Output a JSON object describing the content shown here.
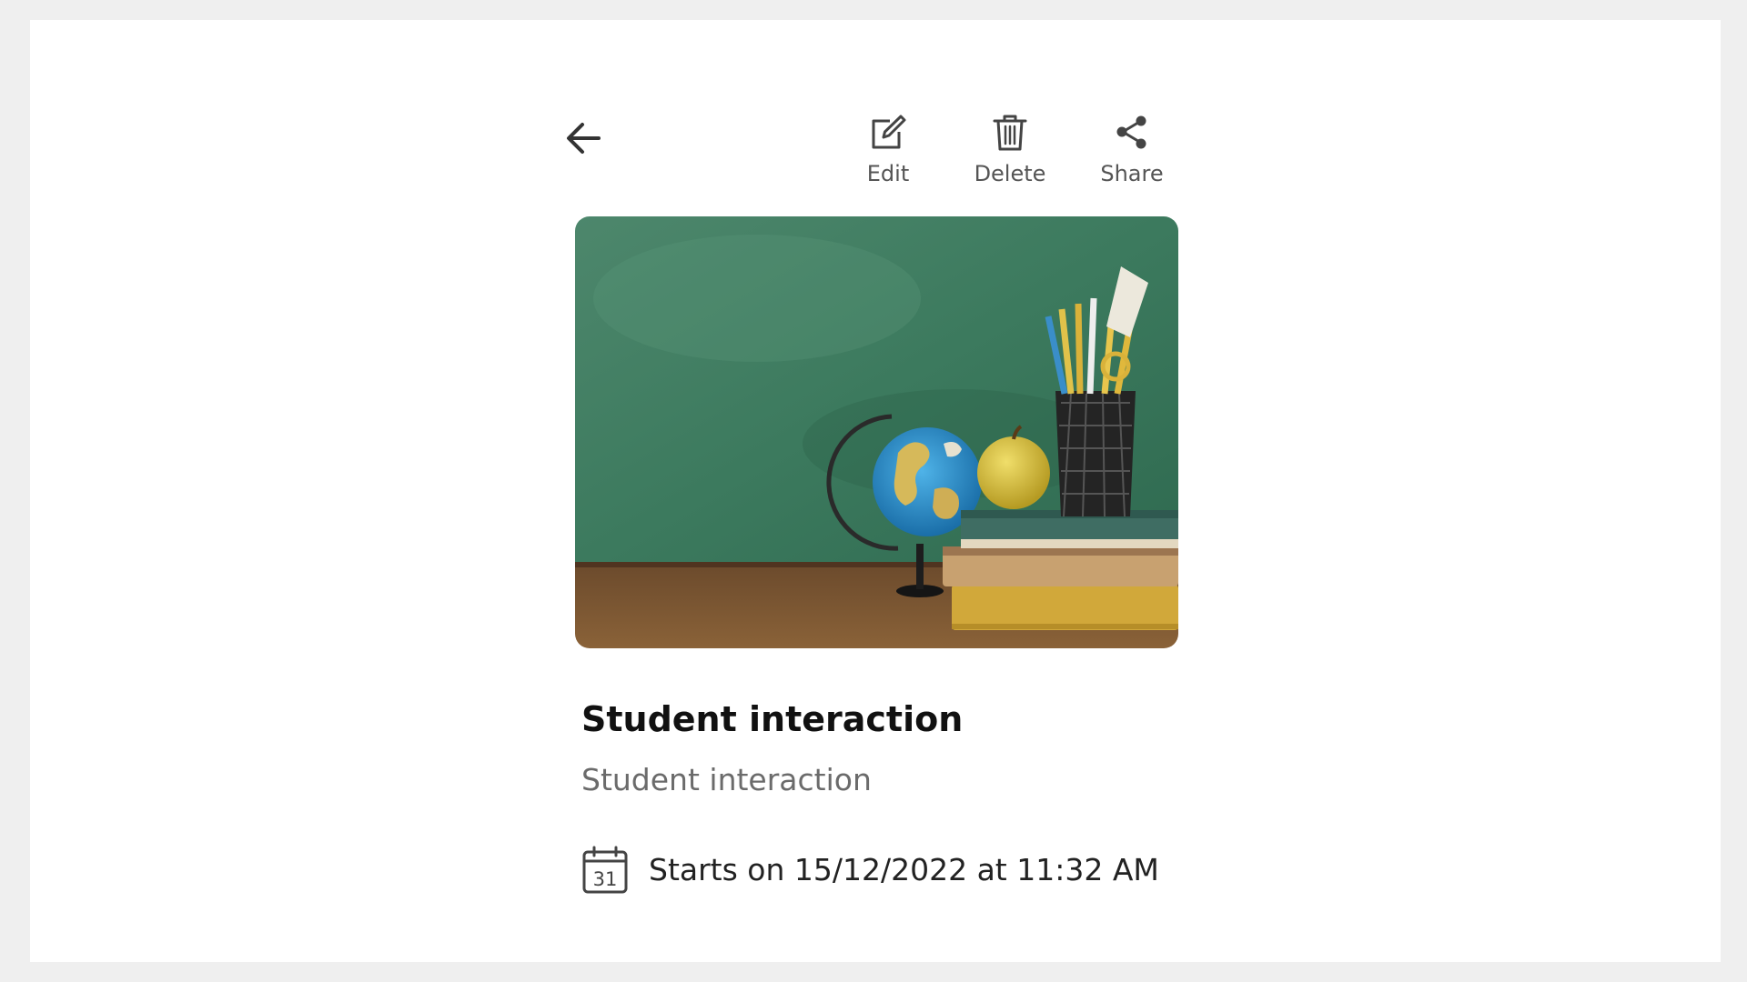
{
  "toolbar": {
    "back_icon": "arrow-left-icon",
    "actions": [
      {
        "label": "Edit",
        "icon": "edit-icon"
      },
      {
        "label": "Delete",
        "icon": "trash-icon"
      },
      {
        "label": "Share",
        "icon": "share-icon"
      }
    ]
  },
  "event": {
    "image": "classroom-desk-globe-apple-books-pencils",
    "title": "Student interaction",
    "description": "Student interaction",
    "calendar_day": "31",
    "start_text": "Starts on 15/12/2022 at 11:32 AM"
  },
  "colors": {
    "background": "#efefef",
    "card": "#ffffff",
    "chalkboard": "#3f7a60",
    "text": "#111111",
    "muted": "#6b6b6b",
    "icon": "#444444"
  }
}
